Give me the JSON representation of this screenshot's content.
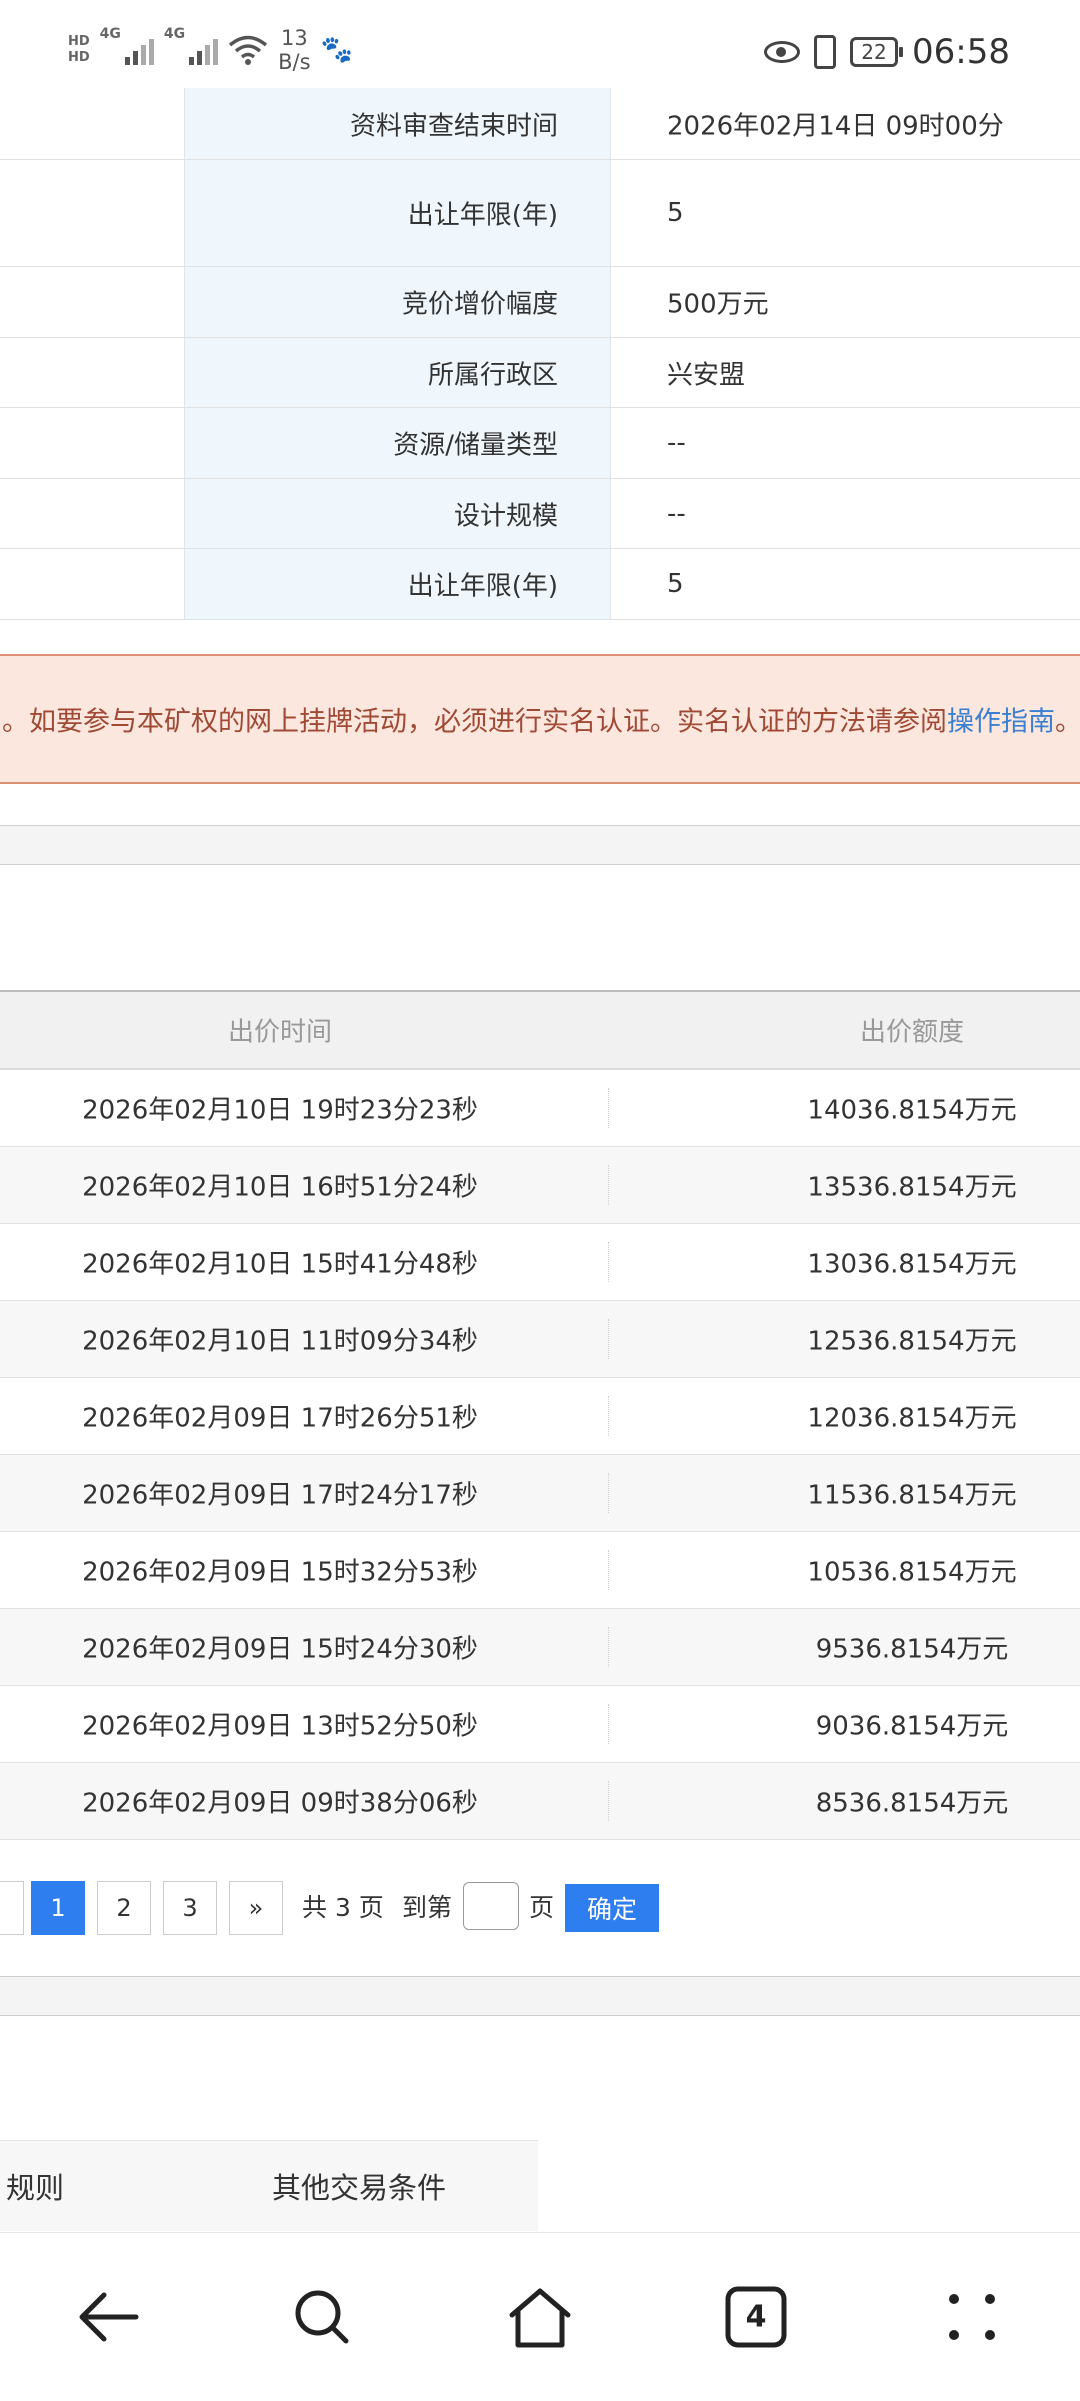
{
  "status_bar": {
    "sim_labels": [
      "HD",
      "HD"
    ],
    "network_1": "4G",
    "network_2": "4G",
    "speed_value": "13",
    "speed_unit": "B/s",
    "battery": "22",
    "time": "06:58"
  },
  "info_rows": [
    {
      "label": "资料审查结束时间",
      "value": "2026年02月14日 09时00分"
    },
    {
      "label": "出让年限(年)",
      "value": "5"
    },
    {
      "label": "竞价增价幅度",
      "value": "500万元"
    },
    {
      "label": "所属行政区",
      "value": "兴安盟"
    },
    {
      "label": "资源/储量类型",
      "value": "--"
    },
    {
      "label": "设计规模",
      "value": "--"
    },
    {
      "label": "出让年限(年)",
      "value": "5"
    }
  ],
  "notice": {
    "text": "。如要参与本矿权的网上挂牌活动，必须进行实名认证。实名认证的方法请参阅",
    "link": "操作指南",
    "tail": "。"
  },
  "bid_table": {
    "headers": {
      "time": "出价时间",
      "amount": "出价额度"
    },
    "rows": [
      {
        "time": "2026年02月10日 19时23分23秒",
        "amount": "14036.8154万元"
      },
      {
        "time": "2026年02月10日 16时51分24秒",
        "amount": "13536.8154万元"
      },
      {
        "time": "2026年02月10日 15时41分48秒",
        "amount": "13036.8154万元"
      },
      {
        "time": "2026年02月10日 11时09分34秒",
        "amount": "12536.8154万元"
      },
      {
        "time": "2026年02月09日 17时26分51秒",
        "amount": "12036.8154万元"
      },
      {
        "time": "2026年02月09日 17时24分17秒",
        "amount": "11536.8154万元"
      },
      {
        "time": "2026年02月09日 15时32分53秒",
        "amount": "10536.8154万元"
      },
      {
        "time": "2026年02月09日 15时24分30秒",
        "amount": "9536.8154万元"
      },
      {
        "time": "2026年02月09日 13时52分50秒",
        "amount": "9036.8154万元"
      },
      {
        "time": "2026年02月09日 09时38分06秒",
        "amount": "8536.8154万元"
      }
    ]
  },
  "pagination": {
    "pages": [
      "1",
      "2",
      "3"
    ],
    "current": "1",
    "next": "»",
    "total_text": "共 3 页",
    "goto_prefix": "到第",
    "goto_suffix": "页",
    "confirm": "确定"
  },
  "bottom_tabs": {
    "tab1": "规则",
    "tab2": "其他交易条件"
  },
  "nav_bar": {
    "tab_count": "4"
  },
  "colors": {
    "accent": "#2f7ef0",
    "label_bg": "#f0f7fc",
    "notice_bg": "#fbe7de",
    "notice_text": "#a04a36"
  }
}
